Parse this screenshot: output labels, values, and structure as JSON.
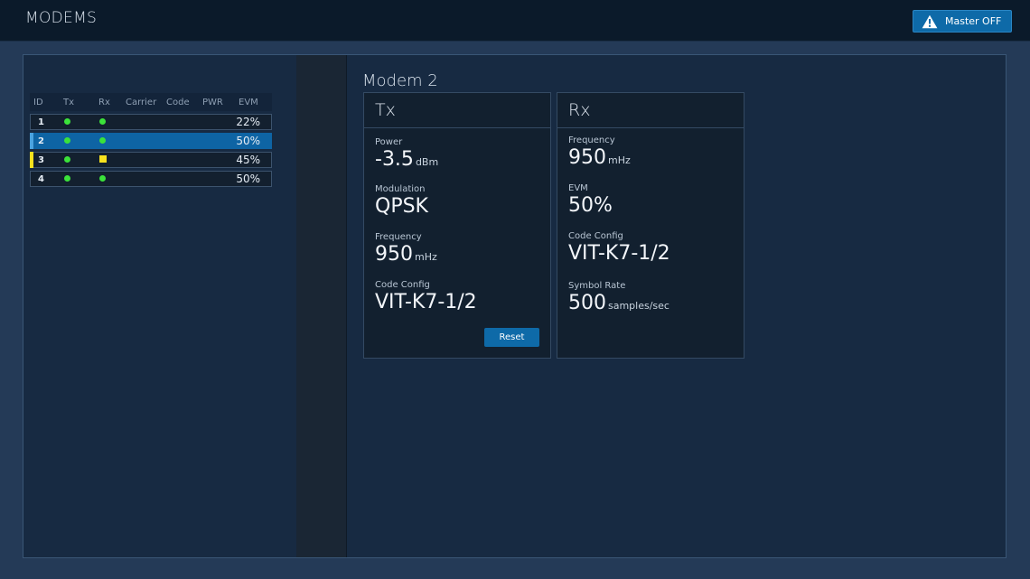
{
  "header": {
    "title": "MODEMS",
    "master_button": {
      "label": "Master OFF",
      "icon": "warning-icon"
    }
  },
  "modem_list": {
    "columns": [
      "ID",
      "Tx",
      "Rx",
      "Carrier",
      "Code",
      "PWR",
      "EVM"
    ],
    "rows": [
      {
        "id": "1",
        "tx": "green-dot",
        "rx": "green-dot",
        "evm": "22%",
        "selected": false,
        "accent": ""
      },
      {
        "id": "2",
        "tx": "green-dot",
        "rx": "green-dot",
        "evm": "50%",
        "selected": true,
        "accent": "#4aa3e0"
      },
      {
        "id": "3",
        "tx": "green-dot",
        "rx": "yellow-square",
        "evm": "45%",
        "selected": false,
        "accent": "#f8e21e"
      },
      {
        "id": "4",
        "tx": "green-dot",
        "rx": "green-dot",
        "evm": "50%",
        "selected": false,
        "accent": ""
      }
    ]
  },
  "detail": {
    "title": "Modem 2",
    "tx": {
      "heading": "Tx",
      "power": {
        "label": "Power",
        "value": "-3.5",
        "unit": "dBm"
      },
      "modulation": {
        "label": "Modulation",
        "value": "QPSK"
      },
      "frequency": {
        "label": "Frequency",
        "value": "950",
        "unit": "mHz"
      },
      "code_config": {
        "label": "Code Config",
        "value": "VIT-K7-1/2"
      },
      "reset_label": "Reset"
    },
    "rx": {
      "heading": "Rx",
      "frequency": {
        "label": "Frequency",
        "value": "950",
        "unit": "mHz"
      },
      "evm": {
        "label": "EVM",
        "value": "50%"
      },
      "code_config": {
        "label": "Code Config",
        "value": "VIT-K7-1/2"
      },
      "symbol_rate": {
        "label": "Symbol Rate",
        "value": "500",
        "unit": "samples/sec"
      }
    }
  },
  "colors": {
    "status_green": "#3be23a",
    "status_yellow": "#f8e21e",
    "accent_blue": "#0e6aa8"
  }
}
